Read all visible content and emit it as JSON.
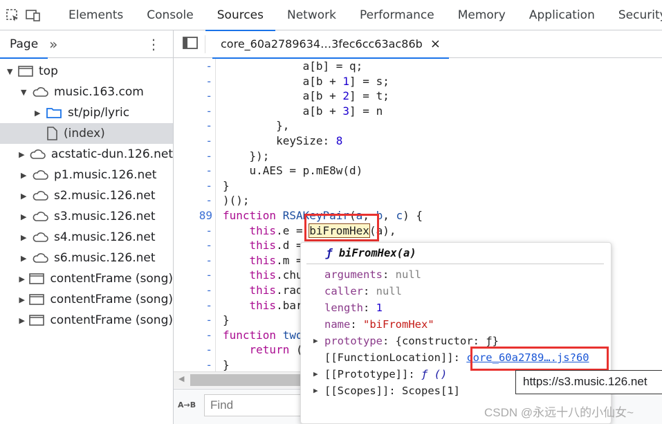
{
  "toolbar": {
    "tabs": [
      "Elements",
      "Console",
      "Sources",
      "Network",
      "Performance",
      "Memory",
      "Application",
      "Security"
    ],
    "active": "Sources"
  },
  "sidebar": {
    "tab": "Page",
    "more": "»",
    "tree": [
      {
        "label": "top",
        "icon": "frame-icon",
        "depth": 0,
        "expanded": true
      },
      {
        "label": "music.163.com",
        "icon": "cloud-icon",
        "depth": 1,
        "expanded": true
      },
      {
        "label": "st/pip/lyric",
        "icon": "folder-icon",
        "depth": 2,
        "expanded": false
      },
      {
        "label": "(index)",
        "icon": "file-icon",
        "depth": 2,
        "selected": true
      },
      {
        "label": "acstatic-dun.126.net",
        "icon": "cloud-icon",
        "depth": 1,
        "expanded": false
      },
      {
        "label": "p1.music.126.net",
        "icon": "cloud-icon",
        "depth": 1,
        "expanded": false
      },
      {
        "label": "s2.music.126.net",
        "icon": "cloud-icon",
        "depth": 1,
        "expanded": false
      },
      {
        "label": "s3.music.126.net",
        "icon": "cloud-icon",
        "depth": 1,
        "expanded": false
      },
      {
        "label": "s4.music.126.net",
        "icon": "cloud-icon",
        "depth": 1,
        "expanded": false
      },
      {
        "label": "s6.music.126.net",
        "icon": "cloud-icon",
        "depth": 1,
        "expanded": false
      },
      {
        "label": "contentFrame (song)",
        "icon": "frame-icon",
        "depth": 1,
        "expanded": false
      },
      {
        "label": "contentFrame (song)",
        "icon": "frame-icon",
        "depth": 1,
        "expanded": false
      },
      {
        "label": "contentFrame (song)",
        "icon": "frame-icon",
        "depth": 1,
        "expanded": false
      }
    ]
  },
  "editor": {
    "file_tab": "core_60a2789634…3fec6cc63ac86b",
    "close": "×",
    "lines": [
      {
        "n": "-",
        "t": [
          [
            "            a[b] = q;",
            ""
          ]
        ]
      },
      {
        "n": "-",
        "t": [
          [
            "            a[b + ",
            ""
          ],
          [
            "1",
            "num"
          ],
          [
            "] = s;",
            ""
          ]
        ]
      },
      {
        "n": "-",
        "t": [
          [
            "            a[b + ",
            ""
          ],
          [
            "2",
            "num"
          ],
          [
            "] = t;",
            ""
          ]
        ]
      },
      {
        "n": "-",
        "t": [
          [
            "            a[b + ",
            ""
          ],
          [
            "3",
            "num"
          ],
          [
            "] = n",
            ""
          ]
        ]
      },
      {
        "n": "-",
        "t": [
          [
            "        },",
            ""
          ]
        ]
      },
      {
        "n": "-",
        "t": [
          [
            "        keySize: ",
            ""
          ],
          [
            "8",
            "num"
          ]
        ]
      },
      {
        "n": "-",
        "t": [
          [
            "    });",
            ""
          ]
        ]
      },
      {
        "n": "-",
        "t": [
          [
            "    u.AES = p.mE8w(d)",
            ""
          ]
        ]
      },
      {
        "n": "-",
        "t": [
          [
            "}",
            ""
          ]
        ]
      },
      {
        "n": "-",
        "t": [
          [
            ")();",
            ""
          ]
        ]
      },
      {
        "n": "89",
        "t": [
          [
            "function",
            "kw"
          ],
          [
            " ",
            ""
          ],
          [
            "RSAKeyPair",
            "fn"
          ],
          [
            "(",
            ""
          ],
          [
            "a",
            "fn"
          ],
          [
            ", ",
            ""
          ],
          [
            "b",
            "fn"
          ],
          [
            ", ",
            ""
          ],
          [
            "c",
            "fn"
          ],
          [
            ") {",
            ""
          ]
        ]
      },
      {
        "n": "-",
        "t": [
          [
            "    ",
            ""
          ],
          [
            "this",
            "kw"
          ],
          [
            ".e = ",
            ""
          ],
          [
            "biFromHex",
            "hl"
          ],
          [
            "(a),",
            ""
          ]
        ]
      },
      {
        "n": "-",
        "t": [
          [
            "    ",
            ""
          ],
          [
            "this",
            "kw"
          ],
          [
            ".d = ",
            ""
          ]
        ]
      },
      {
        "n": "-",
        "t": [
          [
            "    ",
            ""
          ],
          [
            "this",
            "kw"
          ],
          [
            ".m = ",
            ""
          ]
        ]
      },
      {
        "n": "-",
        "t": [
          [
            "    ",
            ""
          ],
          [
            "this",
            "kw"
          ],
          [
            ".chu",
            ""
          ]
        ]
      },
      {
        "n": "-",
        "t": [
          [
            "    ",
            ""
          ],
          [
            "this",
            "kw"
          ],
          [
            ".rad",
            ""
          ]
        ]
      },
      {
        "n": "-",
        "t": [
          [
            "    ",
            ""
          ],
          [
            "this",
            "kw"
          ],
          [
            ".bar",
            ""
          ]
        ]
      },
      {
        "n": "-",
        "t": [
          [
            "}",
            ""
          ]
        ]
      },
      {
        "n": "-",
        "t": [
          [
            "function",
            "kw"
          ],
          [
            " ",
            ""
          ],
          [
            "two",
            "fn"
          ]
        ]
      },
      {
        "n": "-",
        "t": [
          [
            "    ",
            ""
          ],
          [
            "return",
            "kw"
          ],
          [
            " (",
            ""
          ]
        ]
      },
      {
        "n": "-",
        "t": [
          [
            "}",
            ""
          ]
        ]
      }
    ]
  },
  "find": {
    "placeholder": "Find",
    "toggle": "A→B"
  },
  "popup": {
    "f": "ƒ",
    "title": "biFromHex(a)",
    "arguments_key": "arguments",
    "arguments_val": "null",
    "caller_key": "caller",
    "caller_val": "null",
    "length_key": "length",
    "length_val": "1",
    "name_key": "name",
    "name_val": "\"biFromHex\"",
    "prototype_key": "prototype",
    "prototype_val": "{constructor: ƒ}",
    "location_key": "[[FunctionLocation]]",
    "location_val": "core_60a2789….js?60",
    "proto_key": "[[Prototype]]",
    "proto_val": "ƒ ()",
    "scopes_key": "[[Scopes]]",
    "scopes_val": "Scopes[1]"
  },
  "tooltip": "https://s3.music.126.net",
  "watermark": "CSDN @永远十八的小仙女~",
  "colors": {
    "accent": "#1a73e8",
    "annotation": "#e8322f"
  }
}
